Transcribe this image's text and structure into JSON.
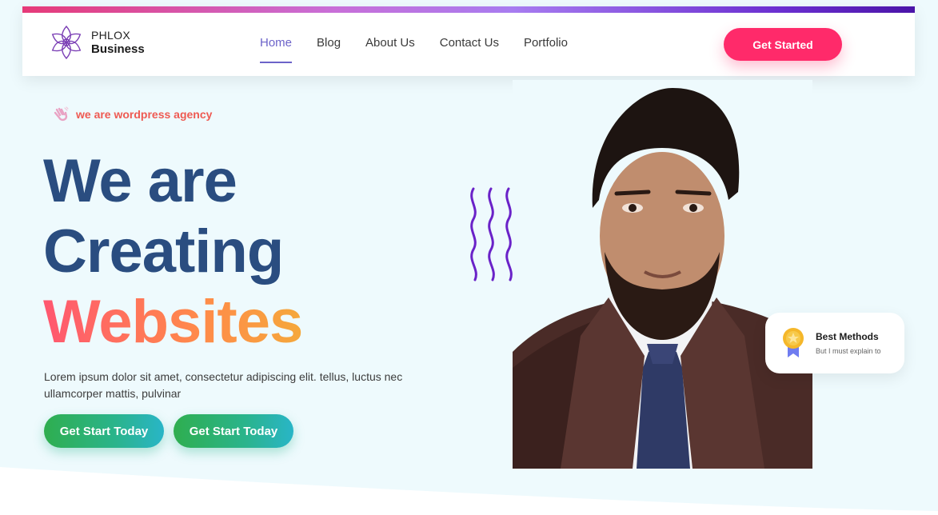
{
  "header": {
    "logo": {
      "line1": "PHLOX",
      "line2": "Business"
    },
    "nav": [
      {
        "label": "Home",
        "active": true
      },
      {
        "label": "Blog",
        "active": false
      },
      {
        "label": "About Us",
        "active": false
      },
      {
        "label": "Contact Us",
        "active": false
      },
      {
        "label": "Portfolio",
        "active": false
      }
    ],
    "cta": "Get Started"
  },
  "hero": {
    "tagline": "we are wordpress agency",
    "title_line1": "We are",
    "title_line2": "Creating",
    "title_line3": "Websites",
    "description": "Lorem ipsum dolor sit amet, consectetur adipiscing elit.  tellus, luctus nec ullamcorper mattis, pulvinar",
    "button1": "Get Start Today",
    "button2": "Get Start Today"
  },
  "badge": {
    "title": "Best Methods",
    "subtitle": "But I must explain to"
  },
  "icons": [
    "flower-logo-icon",
    "waving-hand-icon",
    "medal-icon",
    "wavy-lines-decoration"
  ],
  "colors": {
    "accent_pink": "#ff2a6a",
    "nav_active": "#6c63c9",
    "title_blue": "#2a4d80",
    "tagline_red": "#ee5a52",
    "button_green": "#2fae4f"
  }
}
